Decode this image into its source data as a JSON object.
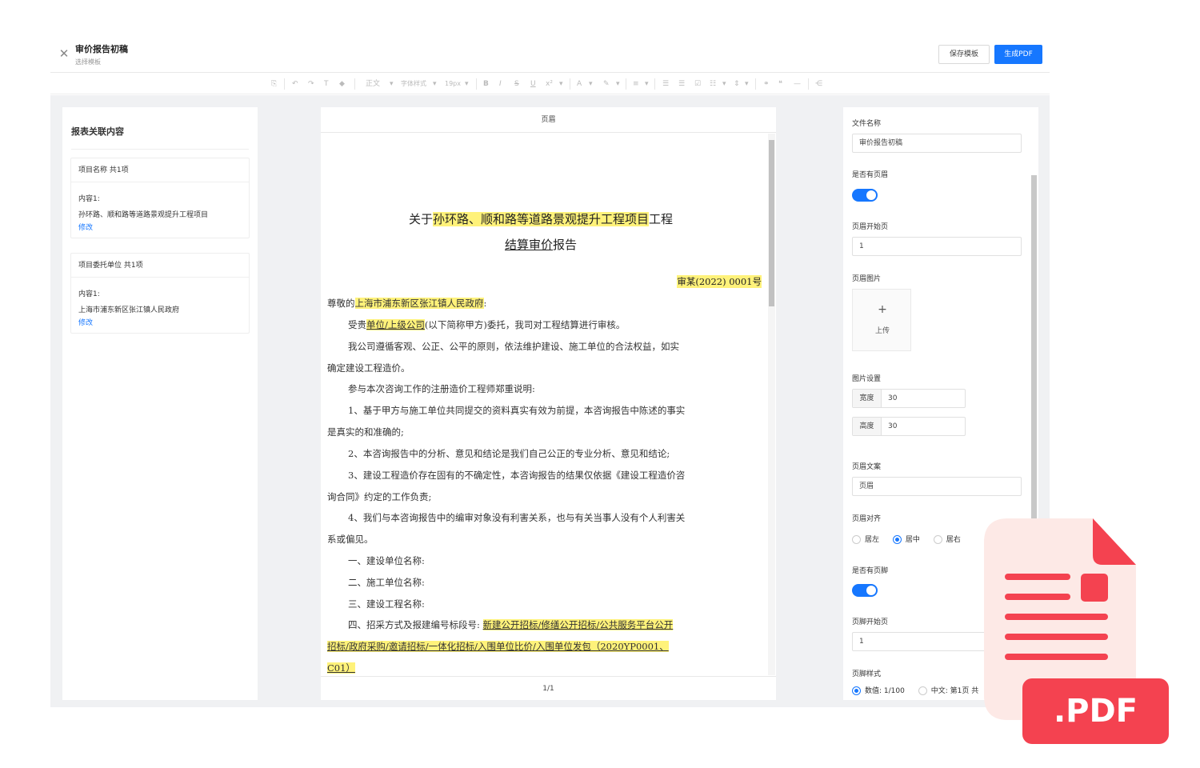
{
  "header": {
    "title": "审价报告初稿",
    "subtitle": "选择模板",
    "save_template": "保存模板",
    "generate_pdf": "生成PDF"
  },
  "toolbar": {
    "paragraph": "正文",
    "font": "字体样式",
    "font_size": "19px"
  },
  "left_panel": {
    "title": "报表关联内容",
    "cards": [
      {
        "head": "项目名称 共1项",
        "label": "内容1:",
        "value": "孙环路、顺和路等道路景观提升工程项目",
        "link": "修改"
      },
      {
        "head": "项目委托单位 共1项",
        "label": "内容1:",
        "value": "上海市浦东新区张江镇人民政府",
        "link": "修改"
      }
    ]
  },
  "document": {
    "header_label": "页眉",
    "footer_label": "1/1",
    "title1_pre": "关于",
    "title1_hl": "孙环路、顺和路等道路景观提升工程项目",
    "title1_post": "工程",
    "title2_hl": "结算审价",
    "title2_post": "报告",
    "ref_no": "审某(2022) 0001号",
    "lines": {
      "dear_pre": "尊敬的",
      "dear_hl": "上海市浦东新区张江镇人民政府",
      "dear_post": ":",
      "p1_pre": "受贵",
      "p1_hl": "单位/上级公司",
      "p1_post": "(以下简称甲方)委托，我司对工程结算进行审核。",
      "p2a": "我公司遵循客观、公正、公平的原则，依法维护建设、施工单位的合法权益，如实",
      "p2b": "确定建设工程造价。",
      "p3": "参与本次咨询工作的注册造价工程师郑重说明:",
      "p4a": "1、基于甲方与施工单位共同提交的资料真实有效为前提，本咨询报告中陈述的事实",
      "p4b": "是真实的和准确的;",
      "p5": "2、本咨询报告中的分析、意见和结论是我们自己公正的专业分析、意见和结论;",
      "p6a": "3、建设工程造价存在固有的不确定性，本咨询报告的结果仅依据《建设工程造价咨",
      "p6b": "询合同》约定的工作负责;",
      "p7a": "4、我们与本咨询报告中的编审对象没有利害关系，也与有关当事人没有个人利害关",
      "p7b": "系或偏见。",
      "s1": "一、建设单位名称:",
      "s2": "二、施工单位名称:",
      "s3": "三、建设工程名称:",
      "s4_pre": "四、招采方式及报建编号标段号: ",
      "s4_hl1": "新建公开招标/修缮公开招标/公共服务平台公开",
      "s4_hl2": "招标/政府采购/邀请招标/一体化招标/入围单位比价/入围单位发包（2020YP0001、",
      "s4_hl3": "C01）"
    }
  },
  "right_panel": {
    "file_name_label": "文件名称",
    "file_name_value": "审价报告初稿",
    "has_header_label": "是否有页眉",
    "header_start_label": "页眉开始页",
    "header_start_value": "1",
    "header_image_label": "页眉图片",
    "upload_plus": "+",
    "upload_text": "上传",
    "image_settings_label": "图片设置",
    "width_label": "宽度",
    "width_value": "30",
    "height_label": "高度",
    "height_value": "30",
    "header_text_label": "页眉文案",
    "header_text_value": "页眉",
    "header_align_label": "页眉对齐",
    "align_left": "居左",
    "align_center": "居中",
    "align_right": "居右",
    "has_footer_label": "是否有页脚",
    "footer_start_label": "页脚开始页",
    "footer_start_value": "1",
    "footer_style_label": "页脚样式",
    "footer_style_numeric": "数值: 1/100",
    "footer_style_chinese": "中文: 第1页 共"
  },
  "pdf_badge": {
    "text": ".PDF"
  },
  "colors": {
    "primary": "#1677ff",
    "highlight": "#fff27a",
    "badge_red": "#f44250",
    "badge_paper": "#fde9e6"
  }
}
